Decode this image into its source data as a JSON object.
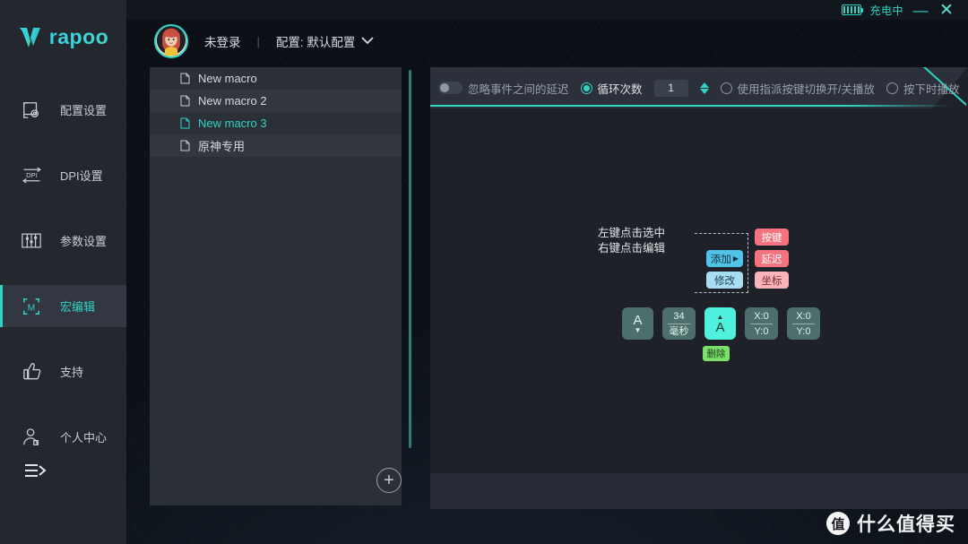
{
  "titlebar": {
    "battery_icon": "battery-charging-icon",
    "charge_label": "充电中",
    "minimize_label": "—",
    "close_label": "✕"
  },
  "brand": {
    "logo_icon": "rapoo-v-logo-icon",
    "name": "rapoo"
  },
  "sidebar": {
    "items": [
      {
        "icon": "config-settings-icon",
        "label": "配置设置",
        "active": false
      },
      {
        "icon": "dpi-settings-icon",
        "label": "DPI设置",
        "active": false
      },
      {
        "icon": "parameter-settings-icon",
        "label": "参数设置",
        "active": false
      },
      {
        "icon": "macro-editor-icon",
        "label": "宏编辑",
        "active": true
      },
      {
        "icon": "thumbs-up-icon",
        "label": "支持",
        "active": false
      },
      {
        "icon": "user-center-icon",
        "label": "个人中心",
        "active": false
      }
    ],
    "collapse_icon": "collapse-menu-icon"
  },
  "header": {
    "avatar_icon": "user-avatar",
    "login_status": "未登录",
    "separator": "|",
    "config_label": "配置: 默认配置",
    "caret_icon": "chevron-down-icon"
  },
  "macro_list": {
    "items": [
      {
        "icon": "document-icon",
        "label": "New macro",
        "selected": false
      },
      {
        "icon": "document-icon",
        "label": "New macro 2",
        "selected": false
      },
      {
        "icon": "document-icon",
        "label": "New macro 3",
        "selected": true
      },
      {
        "icon": "document-icon",
        "label": "原神专用",
        "selected": false
      }
    ],
    "add_button_label": "+",
    "add_button_icon": "plus-circle-icon",
    "scrollbar": "vertical-scrollbar"
  },
  "toolbar": {
    "ignore_delay_label": "忽略事件之间的延迟",
    "ignore_delay_on": false,
    "loop_count_label": "循环次数",
    "loop_count_selected": true,
    "loop_count_value": "1",
    "spinner_icon": "spinner-up-down-icon",
    "toggle_play_label": "使用指派按键切换开/关播放",
    "toggle_play_selected": false,
    "press_play_label": "按下时播放",
    "press_play_selected": false
  },
  "legend": {
    "line1": "左键点击选中",
    "line2": "右键点击编辑",
    "add_label": "添加",
    "add_arrow": "▶",
    "modify_label": "修改",
    "key_label": "按键",
    "delay_label": "延迟",
    "coord_label": "坐标",
    "colors": {
      "add": "#4FC3E8",
      "modify": "#A8DCF2",
      "key": "#F4737F",
      "delay": "#F4737F",
      "coord": "#F9B4BC"
    }
  },
  "events": {
    "blocks": [
      {
        "type": "key-up-block",
        "top": "",
        "letter": "A",
        "bottom": "▼",
        "selected": false
      },
      {
        "type": "delay-block",
        "top": "34",
        "letter": "",
        "bottom": "毫秒",
        "selected": false
      },
      {
        "type": "key-down-block",
        "top": "▲",
        "letter": "A",
        "bottom": "",
        "selected": true
      },
      {
        "type": "coordinate-block",
        "top": "X:0",
        "letter": "",
        "bottom": "Y:0",
        "selected": false
      },
      {
        "type": "coordinate-block",
        "top": "X:0",
        "letter": "",
        "bottom": "Y:0",
        "selected": false
      }
    ],
    "delete_label": "删除",
    "delete_color": "#7AE06A"
  },
  "watermark": {
    "logo_char": "值",
    "text": "什么值得买"
  },
  "theme": {
    "accent": "#2FD4C4",
    "sidebar_bg": "#24272E",
    "panel_bg": "#2B2F36",
    "editor_bg": "#1E2127"
  }
}
